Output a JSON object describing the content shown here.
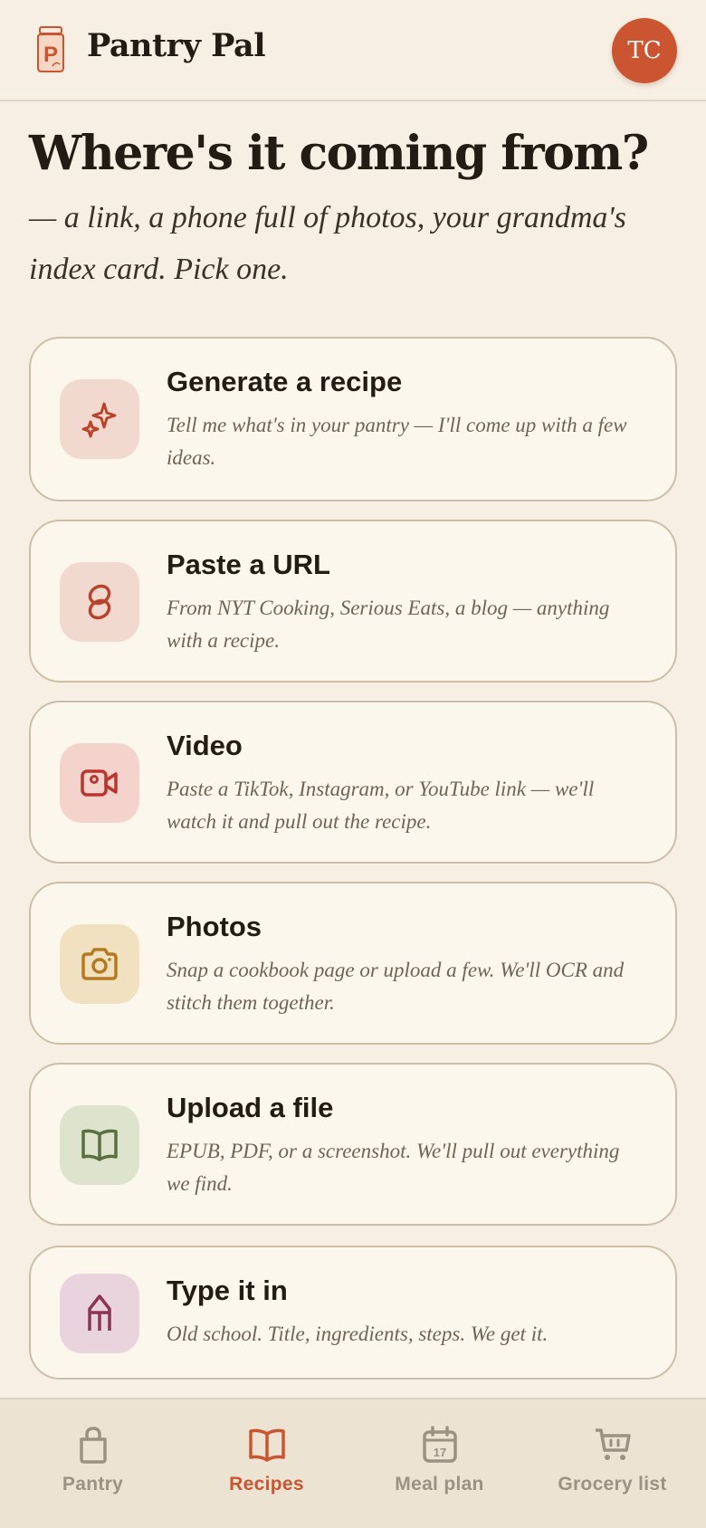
{
  "header": {
    "app_title": "Pantry Pal",
    "avatar_initials": "TC",
    "logo_icon": "jar-logo-icon"
  },
  "main": {
    "headline": "Where's it coming from?",
    "subhead": "— a link, a phone full of photos, your grandma's index card. Pick one.",
    "options": [
      {
        "title": "Generate a recipe",
        "description": "Tell me what's in your pantry — I'll come up with a few ideas.",
        "icon": "sparkle-icon",
        "icon_bg": "#f2d9cf",
        "icon_color": "#b8442c"
      },
      {
        "title": "Paste a URL",
        "description": "From NYT Cooking, Serious Eats, a blog — anything with a recipe.",
        "icon": "link-icon",
        "icon_bg": "#f2d9cf",
        "icon_color": "#b8442c"
      },
      {
        "title": "Video",
        "description": "Paste a TikTok, Instagram, or YouTube link — we'll watch it and pull out the recipe.",
        "icon": "video-icon",
        "icon_bg": "#f4d3cd",
        "icon_color": "#b8362c"
      },
      {
        "title": "Photos",
        "description": "Snap a cookbook page or upload a few. We'll OCR and stitch them together.",
        "icon": "camera-icon",
        "icon_bg": "#f2e1c0",
        "icon_color": "#b47a22"
      },
      {
        "title": "Upload a file",
        "description": "EPUB, PDF, or a screenshot. We'll pull out everything we find.",
        "icon": "book-icon",
        "icon_bg": "#dde3cc",
        "icon_color": "#5a7040"
      },
      {
        "title": "Type it in",
        "description": "Old school. Title, ingredients, steps. We get it.",
        "icon": "pencil-icon",
        "icon_bg": "#e9d3dc",
        "icon_color": "#8a3552"
      }
    ]
  },
  "bottom_nav": {
    "items": [
      {
        "label": "Pantry",
        "icon": "bag-icon",
        "active": false
      },
      {
        "label": "Recipes",
        "icon": "book-icon",
        "active": true
      },
      {
        "label": "Meal plan",
        "icon": "calendar-icon",
        "calendar_day": "17",
        "active": false
      },
      {
        "label": "Grocery list",
        "icon": "cart-icon",
        "active": false
      }
    ]
  },
  "colors": {
    "background": "#f7efe3",
    "card_background": "#fcf7ec",
    "accent": "#cb5530",
    "inactive_nav": "#9b9284"
  }
}
